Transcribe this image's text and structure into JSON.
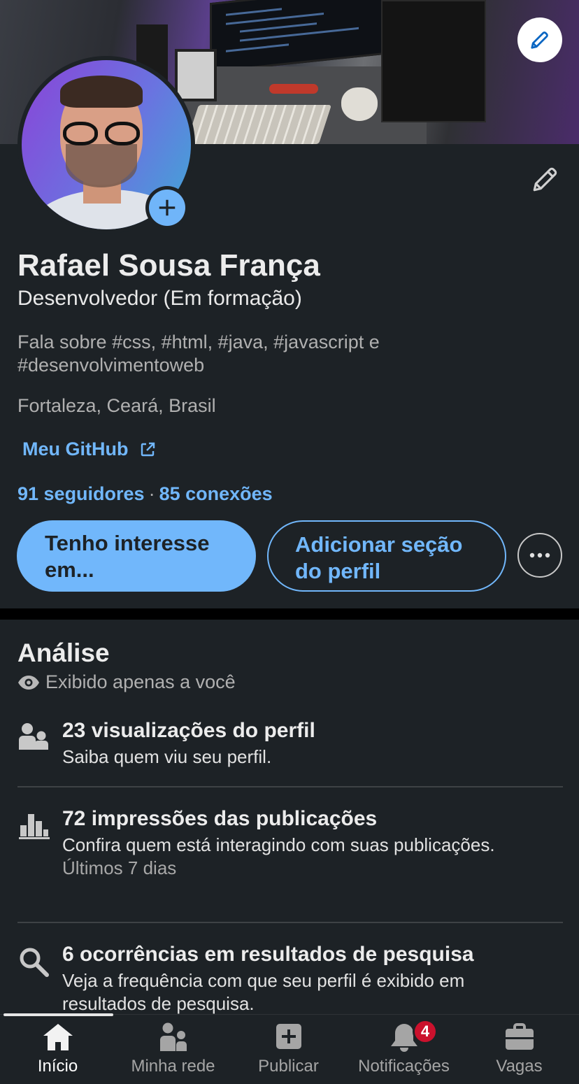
{
  "profile": {
    "name": "Rafael Sousa França",
    "headline": "Desenvolvedor (Em formação)",
    "about": "Fala sobre #css, #html, #java, #javascript e #desenvolvimentoweb",
    "location": "Fortaleza, Ceará, Brasil",
    "link_label": "Meu GitHub",
    "followers": "91 seguidores",
    "separator": "·",
    "connections": "85 conexões"
  },
  "actions": {
    "primary_label": "Tenho interesse em...",
    "secondary_label": "Adicionar seção do perfil",
    "more_icon": "ellipsis-icon"
  },
  "analytics": {
    "title": "Análise",
    "private_note": "Exibido apenas a você",
    "items": [
      {
        "icon": "people-icon",
        "title": "23 visualizações do perfil",
        "desc": "Saiba quem viu seu perfil.",
        "meta": ""
      },
      {
        "icon": "bar-chart-icon",
        "title": "72 impressões das publicações",
        "desc": "Confira quem está interagindo com suas publicações.",
        "meta": "Últimos 7 dias"
      },
      {
        "icon": "search-icon",
        "title": "6 ocorrências em resultados de pesquisa",
        "desc": "Veja a frequência com que seu perfil é exibido em resultados de pesquisa.",
        "meta": ""
      }
    ]
  },
  "nav": {
    "items": [
      {
        "label": "Início",
        "icon": "home-icon",
        "active": true
      },
      {
        "label": "Minha rede",
        "icon": "network-icon",
        "active": false
      },
      {
        "label": "Publicar",
        "icon": "post-icon",
        "active": false
      },
      {
        "label": "Notificações",
        "icon": "bell-icon",
        "active": false,
        "badge": "4"
      },
      {
        "label": "Vagas",
        "icon": "briefcase-icon",
        "active": false
      }
    ]
  },
  "colors": {
    "background": "#1d2226",
    "accent": "#71b7fb",
    "badge": "#cb112d"
  }
}
